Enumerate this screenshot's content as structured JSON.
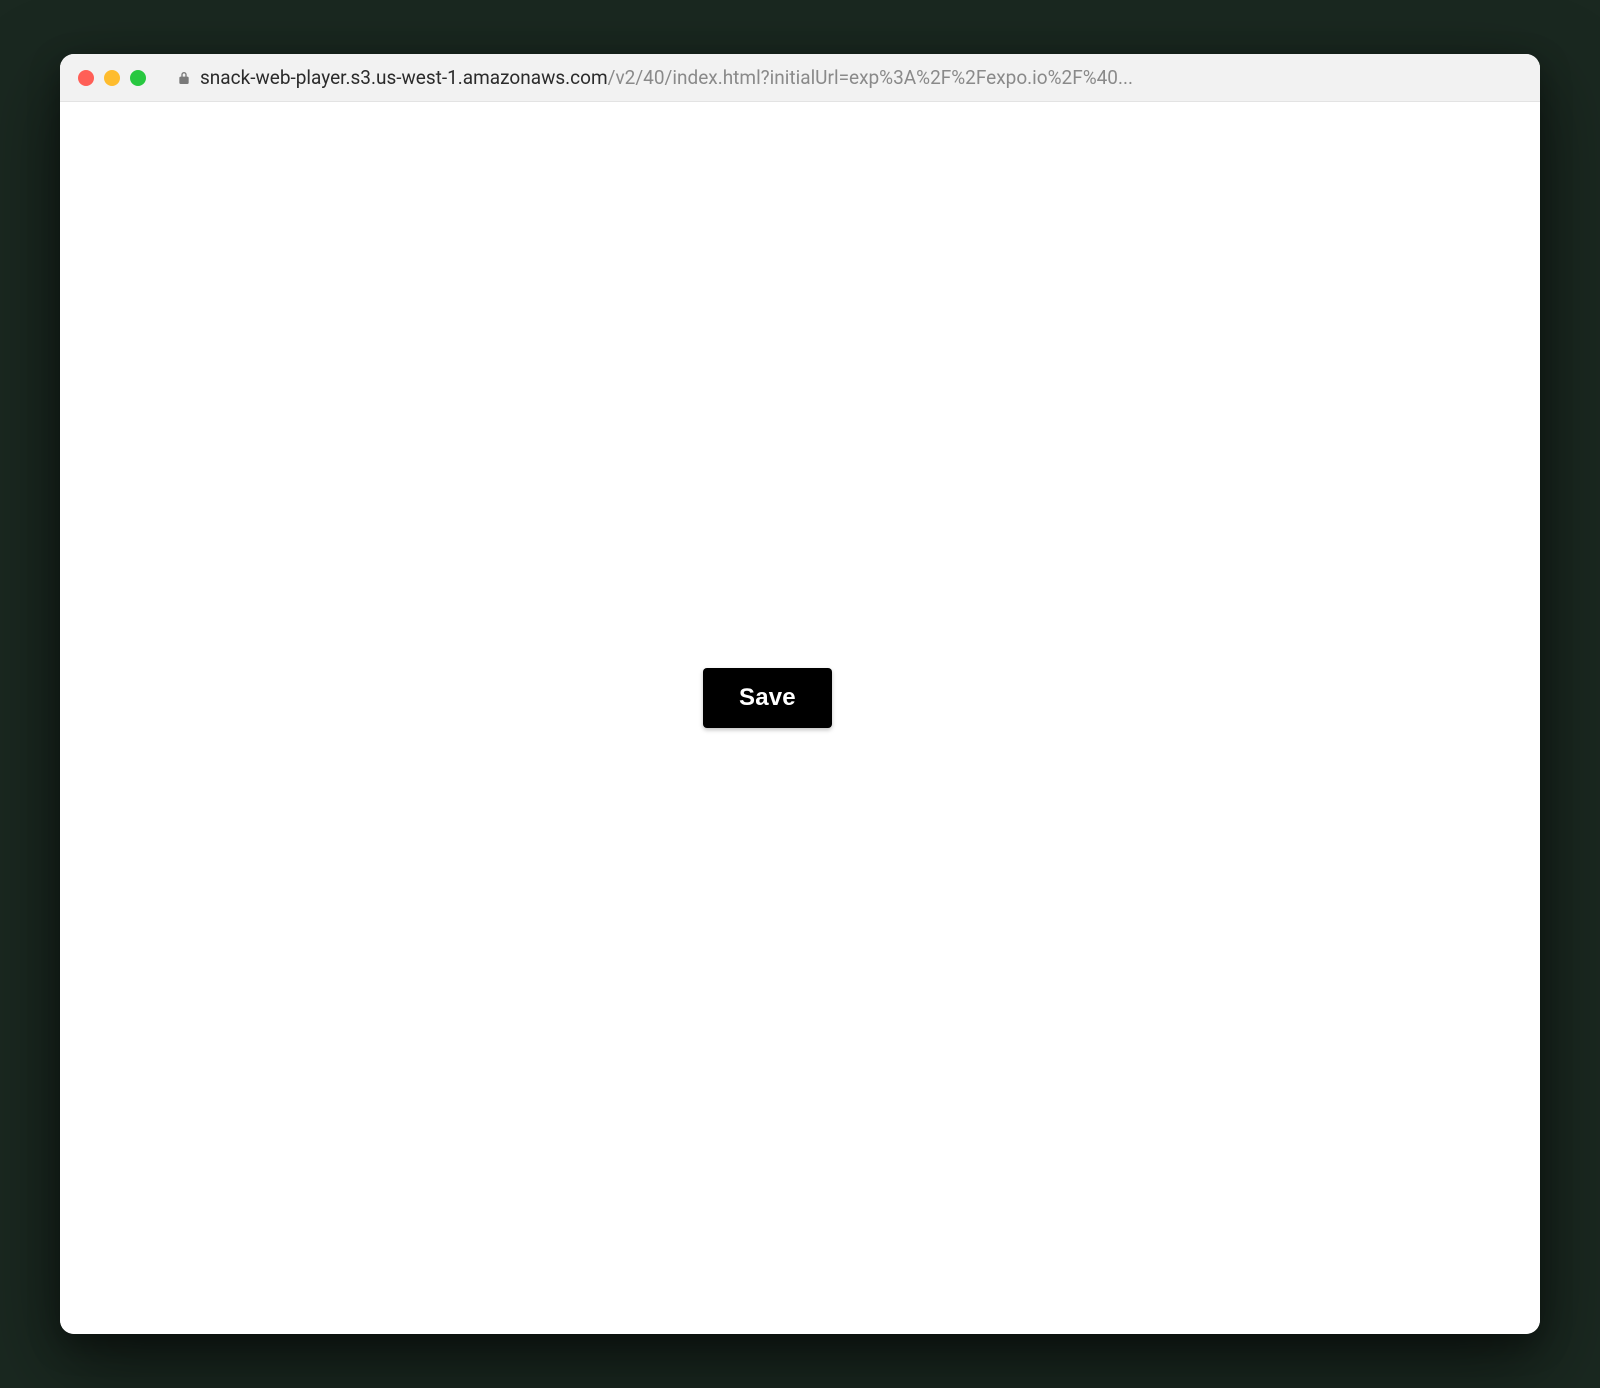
{
  "browser": {
    "url_host": "snack-web-player.s3.us-west-1.amazonaws.com",
    "url_path": "/v2/40/index.html?initialUrl=exp%3A%2F%2Fexpo.io%2F%40...",
    "traffic_lights": {
      "red": "#ff5f57",
      "yellow": "#febc2e",
      "green": "#28c840"
    }
  },
  "page": {
    "save_button_label": "Save"
  }
}
